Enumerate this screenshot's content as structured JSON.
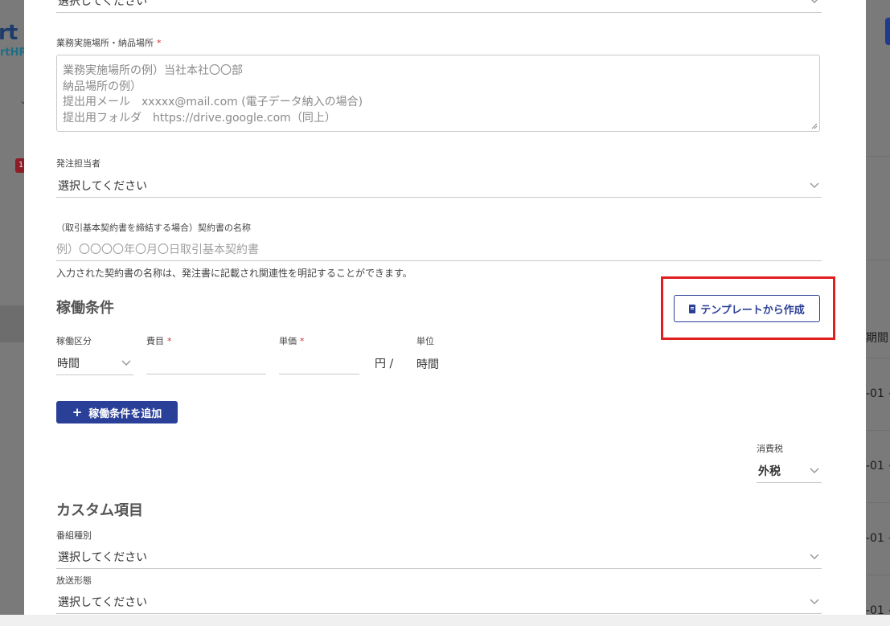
{
  "background": {
    "logo_top": "rt",
    "logo_bottom": "rtHR",
    "badge": "1",
    "right_header": "期間",
    "right_rows": [
      "-01 ~",
      "-01 ~",
      "-01 ~",
      "-01 ~"
    ]
  },
  "form": {
    "top_select_value": "選択してください",
    "location": {
      "label": "業務実施場所・納品場所",
      "required_mark": "*",
      "placeholder_lines": [
        "業務実施場所の例）当社本社〇〇部",
        "納品場所の例）",
        "提出用メール　xxxxx@mail.com (電子データ納入の場合)",
        "提出用フォルダ　https://drive.google.com（同上）"
      ]
    },
    "ordering_person": {
      "label": "発注担当者",
      "value": "選択してください"
    },
    "contract_name": {
      "label": "（取引基本契約書を締結する場合）契約書の名称",
      "placeholder": "例）〇〇〇〇年〇月〇日取引基本契約書",
      "hint": "入力された契約書の名称は、発注書に記載され関連性を明記することができます。"
    }
  },
  "work_conditions": {
    "title": "稼働条件",
    "template_button": "テンプレートから作成",
    "type_label": "稼働区分",
    "type_value": "時間",
    "expense_label": "費目",
    "expense_required": "*",
    "unit_price_label": "単価",
    "unit_price_required": "*",
    "currency_sep": "円 /",
    "unit_label": "単位",
    "unit_value": "時間",
    "add_button": "稼働条件を追加",
    "add_button_icon": "+",
    "tax_label": "消費税",
    "tax_value": "外税"
  },
  "custom_fields": {
    "title": "カスタム項目",
    "program_type": {
      "label": "番組種別",
      "value": "選択してください"
    },
    "broadcast_form": {
      "label": "放送形態",
      "value": "選択してください"
    }
  },
  "colors": {
    "primary": "#2a3f97",
    "required": "#d03030",
    "highlight": "#e01f1f"
  }
}
